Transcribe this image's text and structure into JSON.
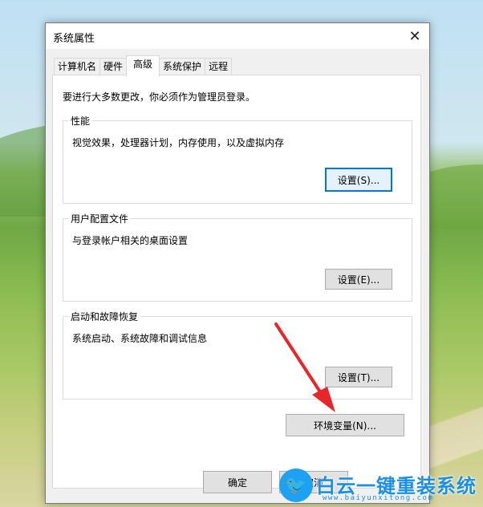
{
  "window": {
    "title": "系统属性",
    "close_symbol": "✕"
  },
  "tabs": [
    {
      "label": "计算机名",
      "active": false
    },
    {
      "label": "硬件",
      "active": false
    },
    {
      "label": "高级",
      "active": true
    },
    {
      "label": "系统保护",
      "active": false
    },
    {
      "label": "远程",
      "active": false
    }
  ],
  "admin_note": "要进行大多数更改，你必须作为管理员登录。",
  "groups": {
    "performance": {
      "title": "性能",
      "description": "视觉效果，处理器计划，内存使用，以及虚拟内存",
      "button": "设置(S)..."
    },
    "user_profiles": {
      "title": "用户配置文件",
      "description": "与登录帐户相关的桌面设置",
      "button": "设置(E)..."
    },
    "startup_recovery": {
      "title": "启动和故障恢复",
      "description": "系统启动、系统故障和调试信息",
      "button": "设置(T)..."
    }
  },
  "env_button": "环境变量(N)...",
  "footer": {
    "ok": "确定",
    "cancel": "取消"
  },
  "watermark": {
    "text": "白云一键重装系统",
    "url": "www.baiyunxitong.com",
    "icon": "twitter-bird-icon"
  },
  "colors": {
    "focus_border": "#0078d7",
    "arrow": "#e8262a",
    "watermark": "#1a8fe3"
  }
}
